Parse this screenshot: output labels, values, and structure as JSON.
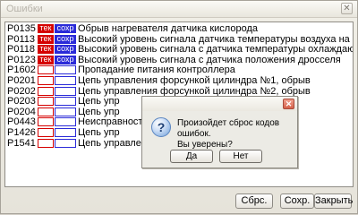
{
  "window": {
    "title": "Ошибки",
    "close_glyph": "✕"
  },
  "tags": {
    "tek": "тек",
    "sokhr": "сохр"
  },
  "errors": [
    {
      "code": "P0135",
      "tek": true,
      "sokhr": true,
      "desc": "Обрыв нагревателя датчика кислорода"
    },
    {
      "code": "P0113",
      "tek": true,
      "sokhr": true,
      "desc": "Высокий уровень сигнала датчика температуры воздуха на впуске"
    },
    {
      "code": "P0118",
      "tek": true,
      "sokhr": true,
      "desc": "Высокий уровень сигнала с датчика температуры охлаждающей жидкости"
    },
    {
      "code": "P0123",
      "tek": true,
      "sokhr": true,
      "desc": "Высокий уровень сигнала с датчика положения дросселя"
    },
    {
      "code": "P1602",
      "tek": false,
      "sokhr": false,
      "desc": "Пропадание питания контроллера"
    },
    {
      "code": "P0201",
      "tek": false,
      "sokhr": false,
      "desc": "Цепь управления форсункой цилиндра №1, обрыв"
    },
    {
      "code": "P0202",
      "tek": false,
      "sokhr": false,
      "desc": "Цепь управления форсункой цилиндра №2, обрыв"
    },
    {
      "code": "P0203",
      "tek": false,
      "sokhr": false,
      "desc": "Цепь упр"
    },
    {
      "code": "P0204",
      "tek": false,
      "sokhr": false,
      "desc": "Цепь упр"
    },
    {
      "code": "P0443",
      "tek": false,
      "sokhr": false,
      "desc": "Неисправность уп"
    },
    {
      "code": "P1426",
      "tek": false,
      "sokhr": false,
      "desc": "Цепь упр"
    },
    {
      "code": "P1541",
      "tek": false,
      "sokhr": false,
      "desc": "Цепь управления"
    }
  ],
  "buttons": {
    "reset": "Сбрс.",
    "save": "Сохр.",
    "close": "Закрыть"
  },
  "dialog": {
    "icon_glyph": "?",
    "message_line1": "Произойдет сброс кодов ошибок.",
    "message_line2": "Вы уверены?",
    "yes": "Да",
    "no": "Нет",
    "close_glyph": "✕"
  },
  "colors": {
    "tek": "#d50000",
    "sokhr": "#2a2ad8"
  }
}
